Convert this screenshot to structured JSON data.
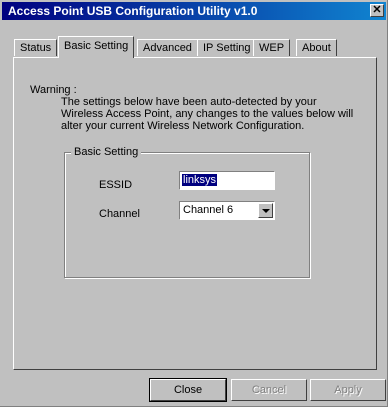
{
  "window": {
    "title": "Access Point USB Configuration Utility v1.0",
    "close_glyph": "✕"
  },
  "tabs": [
    {
      "label": "Status",
      "active": false
    },
    {
      "label": "Basic Setting",
      "active": true
    },
    {
      "label": "Advanced",
      "active": false
    },
    {
      "label": "IP Setting",
      "active": false
    },
    {
      "label": "WEP",
      "active": false
    },
    {
      "label": "About",
      "active": false
    }
  ],
  "warning": {
    "title": "Warning :",
    "text": "The settings below have been auto-detected by your Wireless Access Point, any changes to the values below will alter your current Wireless Network Configuration."
  },
  "basic_setting": {
    "legend": "Basic Setting",
    "essid_label": "ESSID",
    "essid_value": "linksys",
    "channel_label": "Channel",
    "channel_value": "Channel 6"
  },
  "buttons": {
    "close": "Close",
    "cancel": "Cancel",
    "apply": "Apply"
  },
  "colors": {
    "titlebar_start": "#000080",
    "titlebar_end": "#1084d0",
    "face": "#c0c0c0",
    "selection": "#000080"
  }
}
